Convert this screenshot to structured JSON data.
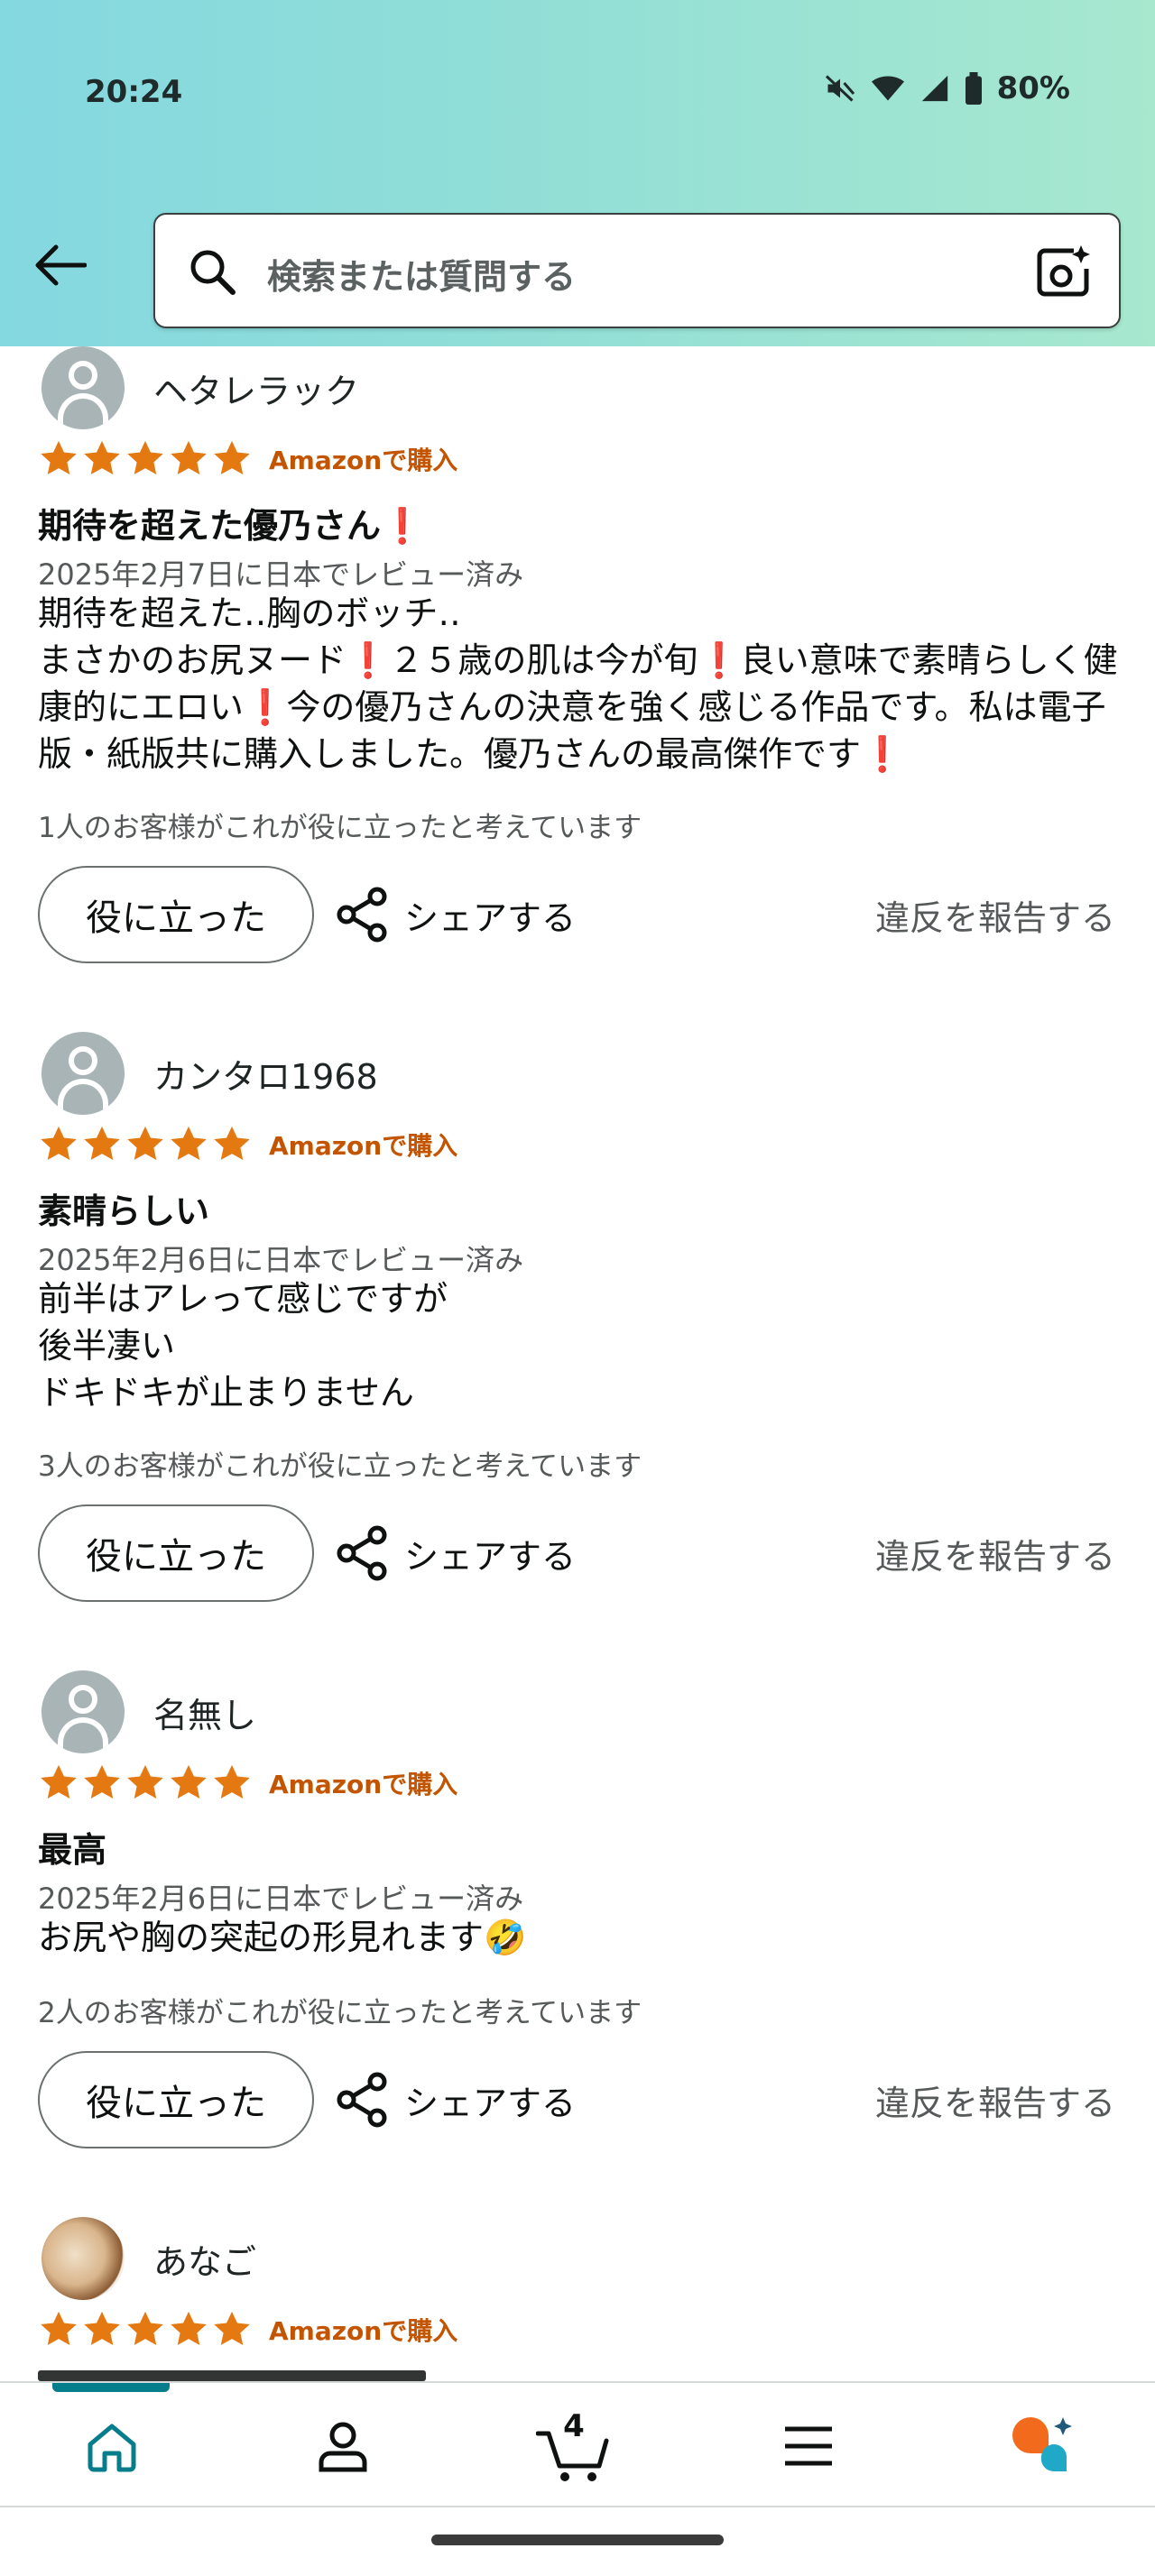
{
  "status_bar": {
    "time": "20:24",
    "battery": "80%"
  },
  "search": {
    "placeholder": "検索または質問する"
  },
  "reviews": [
    {
      "name": "ヘタレラック",
      "rating": 5,
      "badge": "Amazonで購入",
      "title": "期待を超えた優乃さん❗️",
      "date": "2025年2月7日に日本でレビュー済み",
      "body": "期待を超えた‥胸のボッチ‥\nまさかのお尻ヌード❗️２５歳の肌は今が旬❗️良い意味で素晴らしく健康的にエロい❗️今の優乃さんの決意を強く感じる作品です。私は電子版・紙版共に購入しました。優乃さんの最高傑作です❗️",
      "helpful": "1人のお客様がこれが役に立ったと考えています",
      "helpful_button": "役に立った",
      "share": "シェアする",
      "report": "違反を報告する"
    },
    {
      "name": "カンタロ1968",
      "rating": 5,
      "badge": "Amazonで購入",
      "title": "素晴らしい",
      "date": "2025年2月6日に日本でレビュー済み",
      "body": "前半はアレって感じですが\n後半凄い\nドキドキが止まりません",
      "helpful": "3人のお客様がこれが役に立ったと考えています",
      "helpful_button": "役に立った",
      "share": "シェアする",
      "report": "違反を報告する"
    },
    {
      "name": "名無し",
      "rating": 5,
      "badge": "Amazonで購入",
      "title": "最高",
      "date": "2025年2月6日に日本でレビュー済み",
      "body": "お尻や胸の突起の形見れます🤣",
      "helpful": "2人のお客様がこれが役に立ったと考えています",
      "helpful_button": "役に立った",
      "share": "シェアする",
      "report": "違反を報告する"
    },
    {
      "name": "あなご",
      "rating": 5,
      "badge": "Amazonで購入"
    }
  ],
  "bottom_nav": {
    "items": [
      "home-icon",
      "account-icon",
      "cart-icon",
      "menu-icon",
      "rufus-icon"
    ],
    "cart_count": "4"
  },
  "colors": {
    "star": "#e47911",
    "badge": "#c45500",
    "home_active": "#067d8a"
  }
}
